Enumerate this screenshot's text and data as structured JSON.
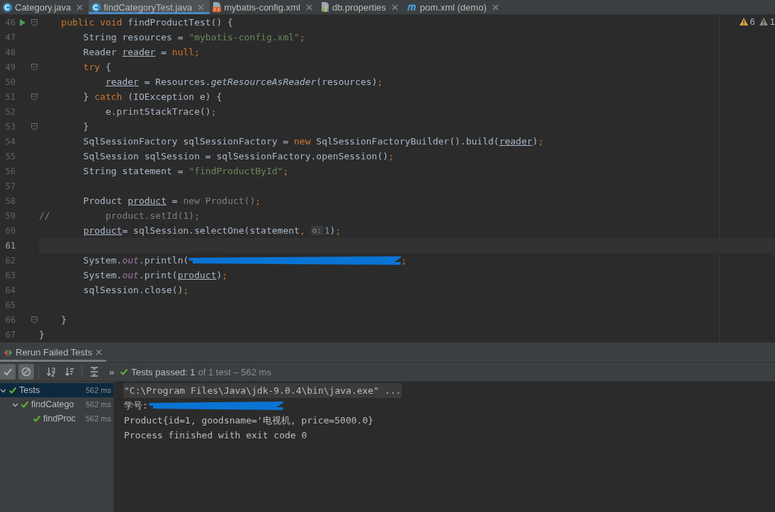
{
  "tabs": [
    {
      "label": "Category.java",
      "kind": "class",
      "selected": false
    },
    {
      "label": "findCategoryTest.java",
      "kind": "class",
      "selected": true
    },
    {
      "label": "mybatis-config.xml",
      "kind": "xml",
      "selected": false
    },
    {
      "label": "db.properties",
      "kind": "properties",
      "selected": false
    },
    {
      "label": "pom.xml (demo)",
      "kind": "maven",
      "selected": false
    }
  ],
  "inspections": [
    {
      "kind": "warning",
      "count": "6"
    },
    {
      "kind": "weak",
      "count": "1"
    }
  ],
  "editor": {
    "lines": [
      {
        "number": "46",
        "current": false,
        "fold": true,
        "run": true,
        "tokens": [
          {
            "kind": "keyword",
            "text": "    public void "
          },
          {
            "kind": "plain",
            "text": "findProductTest() {"
          }
        ]
      },
      {
        "number": "47",
        "current": false,
        "fold": false,
        "run": false,
        "tokens": [
          {
            "kind": "plain",
            "text": "        String resources = "
          },
          {
            "kind": "string",
            "text": "\"mybatis-config.xml\""
          },
          {
            "kind": "keyword",
            "text": ";"
          }
        ]
      },
      {
        "number": "48",
        "current": false,
        "fold": false,
        "run": false,
        "tokens": [
          {
            "kind": "plain",
            "text": "        Reader "
          },
          {
            "kind": "var",
            "text": "reader"
          },
          {
            "kind": "plain",
            "text": " = "
          },
          {
            "kind": "keyword",
            "text": "null;"
          }
        ]
      },
      {
        "number": "49",
        "current": false,
        "fold": true,
        "run": false,
        "tokens": [
          {
            "kind": "keyword",
            "text": "        try"
          },
          {
            "kind": "plain",
            "text": " {"
          }
        ]
      },
      {
        "number": "50",
        "current": false,
        "fold": false,
        "run": false,
        "tokens": [
          {
            "kind": "var",
            "text": "            reader"
          },
          {
            "kind": "plain",
            "text": " = Resources."
          },
          {
            "kind": "method",
            "text": "getResourceAsReader"
          },
          {
            "kind": "plain",
            "text": "(resources)"
          },
          {
            "kind": "keyword",
            "text": ";"
          }
        ]
      },
      {
        "number": "51",
        "current": false,
        "fold": true,
        "run": false,
        "tokens": [
          {
            "kind": "plain",
            "text": "        } "
          },
          {
            "kind": "keyword",
            "text": "catch"
          },
          {
            "kind": "plain",
            "text": " (IOException e) {"
          }
        ]
      },
      {
        "number": "52",
        "current": false,
        "fold": false,
        "run": false,
        "tokens": [
          {
            "kind": "plain",
            "text": "            e.printStackTrace()"
          },
          {
            "kind": "keyword",
            "text": ";"
          }
        ]
      },
      {
        "number": "53",
        "current": false,
        "fold": true,
        "run": false,
        "tokens": [
          {
            "kind": "plain",
            "text": "        }"
          }
        ]
      },
      {
        "number": "54",
        "current": false,
        "fold": false,
        "run": false,
        "tokens": [
          {
            "kind": "plain",
            "text": "        SqlSessionFactory sqlSessionFactory = "
          },
          {
            "kind": "keyword",
            "text": "new "
          },
          {
            "kind": "plain",
            "text": "SqlSessionFactoryBuilder().build("
          },
          {
            "kind": "var",
            "text": "reader"
          },
          {
            "kind": "plain",
            "text": ")"
          },
          {
            "kind": "keyword",
            "text": ";"
          }
        ]
      },
      {
        "number": "55",
        "current": false,
        "fold": false,
        "run": false,
        "tokens": [
          {
            "kind": "plain",
            "text": "        SqlSession sqlSession = sqlSessionFactory.openSession()"
          },
          {
            "kind": "keyword",
            "text": ";"
          }
        ]
      },
      {
        "number": "56",
        "current": false,
        "fold": false,
        "run": false,
        "tokens": [
          {
            "kind": "plain",
            "text": "        String statement = "
          },
          {
            "kind": "string",
            "text": "\"findProductById\""
          },
          {
            "kind": "keyword",
            "text": ";"
          }
        ]
      },
      {
        "number": "57",
        "current": false,
        "fold": false,
        "run": false
      },
      {
        "number": "58",
        "current": false,
        "fold": false,
        "run": false,
        "tokens": [
          {
            "kind": "plain",
            "text": "        Product "
          },
          {
            "kind": "var",
            "text": "product"
          },
          {
            "kind": "plain",
            "text": " = "
          },
          {
            "kind": "unused",
            "text": "new Product()"
          },
          {
            "kind": "keyword",
            "text": ";"
          }
        ]
      },
      {
        "number": "59",
        "current": false,
        "fold": false,
        "run": false,
        "tokens": [
          {
            "kind": "comment",
            "text": "//          product.setId(1);"
          }
        ]
      },
      {
        "number": "60",
        "current": false,
        "fold": false,
        "run": false,
        "tokens": [
          {
            "kind": "var",
            "text": "        product"
          },
          {
            "kind": "plain",
            "text": "= sqlSession.selectOne(statement"
          },
          {
            "kind": "keyword",
            "text": ", "
          },
          {
            "kind": "hint",
            "text": "o:"
          },
          {
            "kind": "number",
            "text": "1"
          },
          {
            "kind": "plain",
            "text": ")"
          },
          {
            "kind": "keyword",
            "text": ";"
          }
        ]
      },
      {
        "number": "61",
        "current": true,
        "fold": false,
        "run": false
      },
      {
        "number": "62",
        "current": false,
        "fold": false,
        "run": false,
        "tokens": [
          {
            "kind": "plain",
            "text": "        System."
          },
          {
            "kind": "field",
            "text": "out"
          },
          {
            "kind": "plain",
            "text": ".println("
          },
          {
            "kind": "redaction"
          },
          {
            "kind": "keyword",
            "text": ";"
          }
        ]
      },
      {
        "number": "63",
        "current": false,
        "fold": false,
        "run": false,
        "tokens": [
          {
            "kind": "plain",
            "text": "        System."
          },
          {
            "kind": "field",
            "text": "out"
          },
          {
            "kind": "plain",
            "text": ".print("
          },
          {
            "kind": "var",
            "text": "product"
          },
          {
            "kind": "plain",
            "text": ")"
          },
          {
            "kind": "keyword",
            "text": ";"
          }
        ]
      },
      {
        "number": "64",
        "current": false,
        "fold": false,
        "run": false,
        "tokens": [
          {
            "kind": "plain",
            "text": "        sqlSession.close()"
          },
          {
            "kind": "keyword",
            "text": ";"
          }
        ]
      },
      {
        "number": "65",
        "current": false,
        "fold": false,
        "run": false
      },
      {
        "number": "66",
        "current": false,
        "fold": true,
        "run": false,
        "tokens": [
          {
            "kind": "plain",
            "text": "    }"
          }
        ]
      },
      {
        "number": "67",
        "current": false,
        "fold": false,
        "run": false,
        "tokens": [
          {
            "kind": "plain",
            "text": "}"
          }
        ]
      }
    ]
  },
  "run_panel": {
    "tab": {
      "label": "Rerun Failed Tests",
      "selected": true
    },
    "toolbar": [
      {
        "kind": "show-passed",
        "selected": true
      },
      {
        "kind": "show-ignored",
        "selected": true
      },
      {
        "kind": "sort-alpha",
        "selected": false
      },
      {
        "kind": "sort-duration",
        "selected": false
      },
      {
        "kind": "expand",
        "selected": false
      }
    ],
    "more": "»",
    "status": {
      "passed": "Tests passed: 1",
      "detail": "of 1 test – 562 ms"
    },
    "tree": [
      {
        "label": "Tests",
        "time": "562 ms",
        "selected": true,
        "expanded": true,
        "children": [
          {
            "label": "findCatego",
            "time": "562 ms",
            "selected": false,
            "expanded": true,
            "children": [
              {
                "label": "findProc",
                "time": "562 ms",
                "selected": false
              }
            ]
          }
        ]
      }
    ],
    "console": [
      {
        "kind": "command",
        "tokens": [
          {
            "kind": "text",
            "text": "\"C:\\Program Files\\Java\\jdk-9.0.4\\bin\\java.exe\" ..."
          }
        ]
      },
      {
        "kind": "output",
        "tokens": [
          {
            "kind": "text",
            "text": "学号:"
          },
          {
            "kind": "redaction"
          }
        ]
      },
      {
        "kind": "output",
        "tokens": [
          {
            "kind": "text",
            "text": "Product{id=1, goodsname='电视机, price=5000.0}"
          }
        ]
      },
      {
        "kind": "output",
        "tokens": [
          {
            "kind": "text",
            "text": "Process finished with exit code 0"
          }
        ]
      }
    ]
  }
}
